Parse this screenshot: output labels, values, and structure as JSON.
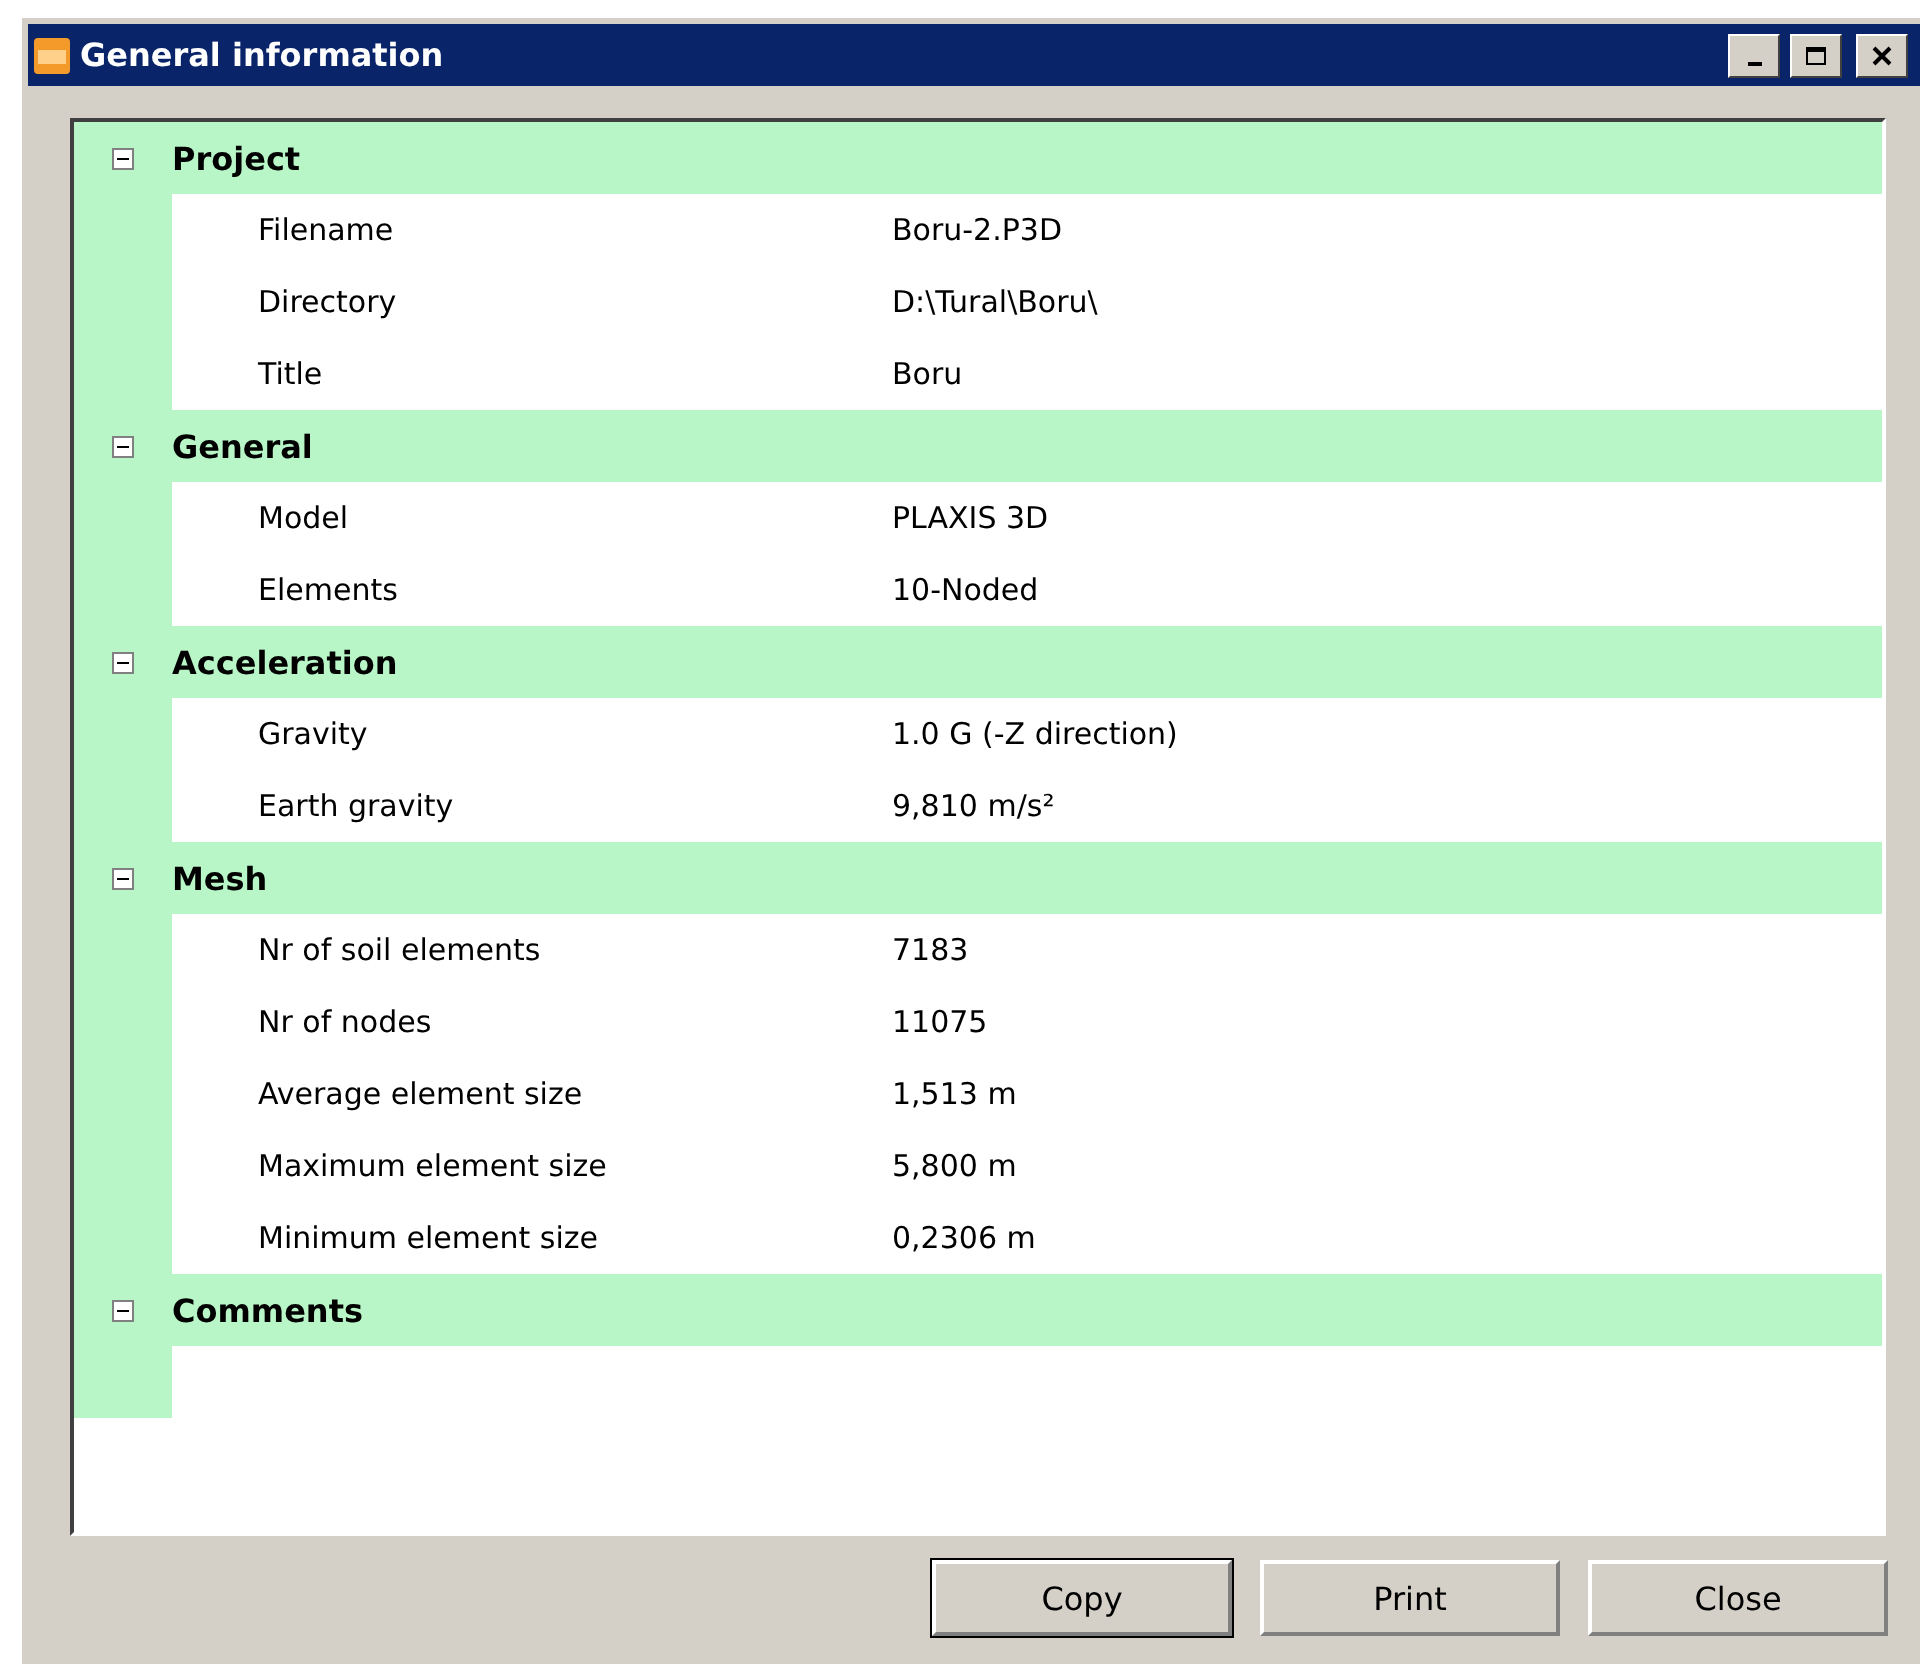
{
  "window": {
    "title": "General information"
  },
  "sections": [
    {
      "title": "Project",
      "expanded": true,
      "rows": [
        {
          "label": "Filename",
          "value": "Boru-2.P3D"
        },
        {
          "label": "Directory",
          "value": "D:\\Tural\\Boru\\"
        },
        {
          "label": "Title",
          "value": "Boru"
        }
      ]
    },
    {
      "title": "General",
      "expanded": true,
      "rows": [
        {
          "label": "Model",
          "value": "PLAXIS 3D"
        },
        {
          "label": "Elements",
          "value": "10-Noded"
        }
      ]
    },
    {
      "title": "Acceleration",
      "expanded": true,
      "rows": [
        {
          "label": "Gravity",
          "value": "1.0 G (-Z direction)"
        },
        {
          "label": "Earth gravity",
          "value": "9,810 m/s²"
        }
      ]
    },
    {
      "title": "Mesh",
      "expanded": true,
      "rows": [
        {
          "label": "Nr of soil elements",
          "value": "7183"
        },
        {
          "label": "Nr of nodes",
          "value": "11075"
        },
        {
          "label": "Average element size",
          "value": "1,513 m"
        },
        {
          "label": "Maximum element size",
          "value": "5,800 m"
        },
        {
          "label": "Minimum element size",
          "value": "0,2306 m"
        }
      ]
    },
    {
      "title": "Comments",
      "expanded": true
    }
  ],
  "buttons": [
    {
      "label": "Copy",
      "default": true
    },
    {
      "label": "Print",
      "default": false
    },
    {
      "label": "Close",
      "default": false
    }
  ]
}
